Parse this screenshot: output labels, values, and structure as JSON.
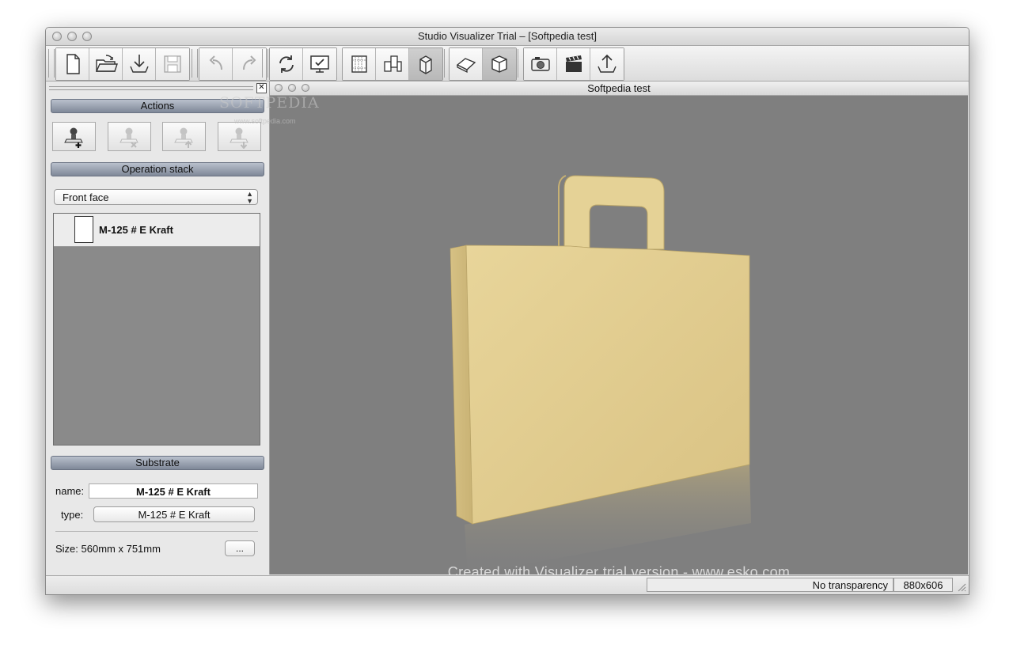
{
  "window": {
    "title": "Studio Visualizer Trial – [Softpedia test]"
  },
  "toolbar": {
    "groups": [
      [
        "new-document-icon",
        "open-folder-icon",
        "import-download-icon",
        "save-disk-icon"
      ],
      [
        "undo-icon",
        "redo-icon"
      ],
      [
        "refresh-rotate-icon",
        "monitor-check-icon"
      ],
      [
        "grid-view-icon",
        "layout-blocks-icon",
        "dimension-box-icon"
      ],
      [
        "flat-box-icon",
        "cube-icon"
      ],
      [
        "camera-icon",
        "clapperboard-icon",
        "export-upload-icon"
      ]
    ]
  },
  "left_panel": {
    "actions_header": "Actions",
    "operation_stack_header": "Operation stack",
    "face_select": "Front face",
    "stack_items": [
      {
        "label": "M-125 # E Kraft"
      }
    ],
    "substrate_header": "Substrate",
    "name_label": "name:",
    "name_value": "M-125 # E Kraft",
    "type_label": "type:",
    "type_value": "M-125 # E Kraft",
    "size_text": "Size: 560mm x 751mm",
    "more_button": "..."
  },
  "viewport": {
    "title": "Softpedia test",
    "watermark": "Created with Visualizer trial version - www.esko.com"
  },
  "status": {
    "transparency": "No transparency",
    "resolution": "880x606"
  },
  "overlay": {
    "softpedia_logo": "SOFTPEDIA",
    "softpedia_url": "www.softpedia.com"
  }
}
